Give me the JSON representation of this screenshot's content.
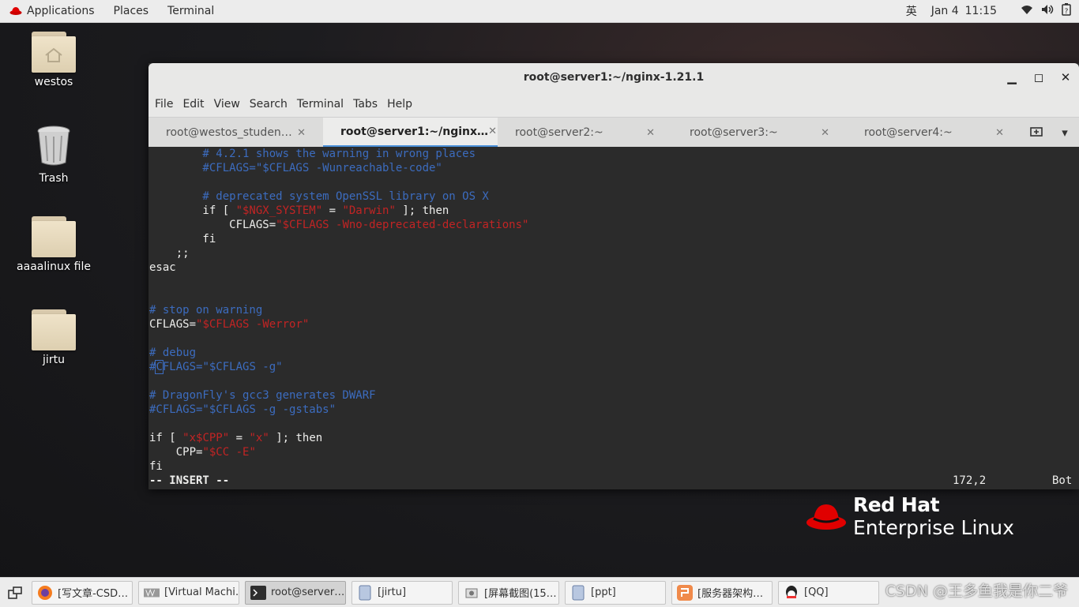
{
  "topbar": {
    "applications": "Applications",
    "places": "Places",
    "terminal": "Terminal",
    "input_method": "英",
    "date": "Jan 4",
    "time": "11:15"
  },
  "desktop": {
    "icons": [
      {
        "label": "westos"
      },
      {
        "label": "Trash"
      },
      {
        "label": "aaaalinux file"
      },
      {
        "label": "jirtu"
      }
    ]
  },
  "window": {
    "title": "root@server1:~/nginx-1.21.1",
    "menu": [
      "File",
      "Edit",
      "View",
      "Search",
      "Terminal",
      "Tabs",
      "Help"
    ],
    "tabs": [
      {
        "label": "root@westos_studen…",
        "active": false
      },
      {
        "label": "root@server1:~/nginx…",
        "active": true
      },
      {
        "label": "root@server2:~",
        "active": false
      },
      {
        "label": "root@server3:~",
        "active": false
      },
      {
        "label": "root@server4:~",
        "active": false
      }
    ]
  },
  "terminal": {
    "l1": "        # 4.2.1 shows the warning in wrong places",
    "l2": "        #CFLAGS=\"$CFLAGS -Wunreachable-code\"",
    "l4": "        # deprecated system OpenSSL library on OS X",
    "l5a": "        if [ ",
    "l5b": "\"$NGX_SYSTEM\"",
    "l5c": " = ",
    "l5d": "\"Darwin\"",
    "l5e": " ]; then",
    "l6a": "            CFLAGS=",
    "l6b": "\"$CFLAGS -Wno-deprecated-declarations\"",
    "l7": "        fi",
    "l8": "    ;;",
    "l9": "esac",
    "l12": "# stop on warning",
    "l13a": "CFLAGS=",
    "l13b": "\"$CFLAGS -Werror\"",
    "l15": "# debug",
    "l16a": "#",
    "l16b": "C",
    "l16c": "FLAGS=\"$CFLAGS -g\"",
    "l18": "# DragonFly's gcc3 generates DWARF",
    "l19": "#CFLAGS=\"$CFLAGS -g -gstabs\"",
    "l21a": "if [ ",
    "l21b": "\"x$CPP\"",
    "l21c": " = ",
    "l21d": "\"x\"",
    "l21e": " ]; then",
    "l22a": "    CPP=",
    "l22b": "\"$CC -E\"",
    "l23": "fi",
    "status_mode": "-- INSERT --",
    "status_pos": "172,2",
    "status_scroll": "Bot"
  },
  "brand": {
    "line1": "Red Hat",
    "line2": "Enterprise Linux"
  },
  "taskbar": {
    "items": [
      {
        "label": "[写文章-CSD…",
        "icon": "firefox-icon"
      },
      {
        "label": "[Virtual Machi…",
        "icon": "virt-manager-icon"
      },
      {
        "label": "root@server…",
        "icon": "terminal-icon"
      },
      {
        "label": "[jirtu]",
        "icon": "file-manager-icon"
      },
      {
        "label": "[屏幕截图(15…",
        "icon": "screenshot-icon"
      },
      {
        "label": "[ppt]",
        "icon": "file-manager-icon"
      },
      {
        "label": "[服务器架构…",
        "icon": "wps-icon"
      },
      {
        "label": "[QQ]",
        "icon": "qq-icon"
      }
    ],
    "watermark": "CSDN @王多鱼我是你二爷"
  }
}
